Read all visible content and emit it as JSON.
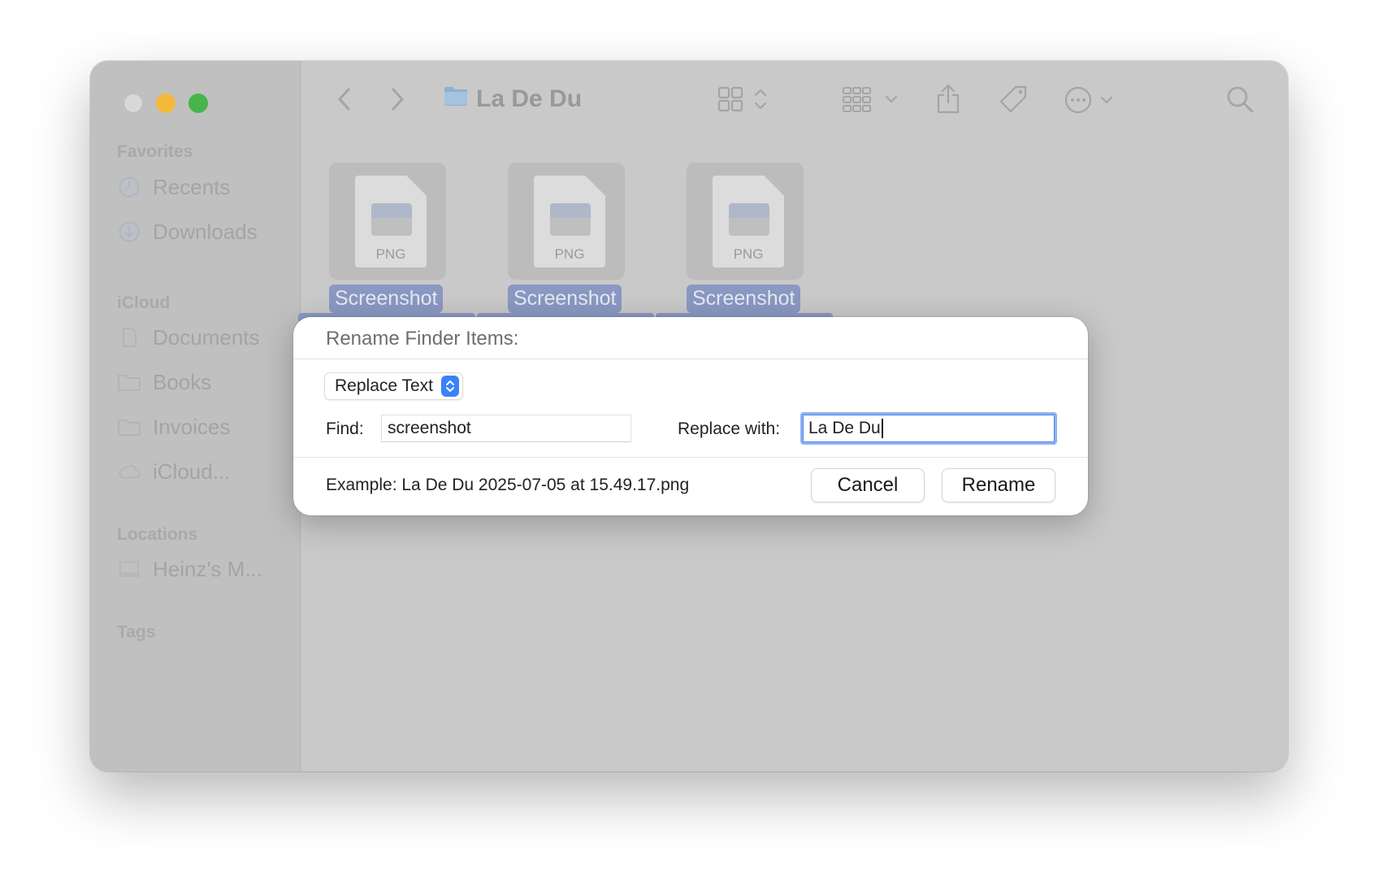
{
  "window": {
    "title": "La De Du"
  },
  "sidebar": {
    "sections": [
      {
        "label": "Favorites",
        "items": [
          {
            "label": "Recents",
            "icon": "clock-icon"
          },
          {
            "label": "Downloads",
            "icon": "download-circle-icon"
          }
        ]
      },
      {
        "label": "iCloud",
        "items": [
          {
            "label": "Documents",
            "icon": "document-icon"
          },
          {
            "label": "Books",
            "icon": "folder-icon"
          },
          {
            "label": "Invoices",
            "icon": "folder-icon"
          },
          {
            "label": "iCloud...",
            "icon": "cloud-icon"
          }
        ]
      },
      {
        "label": "Locations",
        "items": [
          {
            "label": "Heinz's M...",
            "icon": "laptop-icon"
          }
        ]
      },
      {
        "label": "Tags",
        "items": []
      }
    ]
  },
  "files": [
    {
      "ext": "PNG",
      "label": "Screenshot"
    },
    {
      "ext": "PNG",
      "label": "Screenshot"
    },
    {
      "ext": "PNG",
      "label": "Screenshot"
    }
  ],
  "dialog": {
    "title": "Rename Finder Items:",
    "mode_select": "Replace Text",
    "find_label": "Find:",
    "find_value": "screenshot",
    "replace_label": "Replace with:",
    "replace_value": "La De Du",
    "example": "Example: La De Du 2025-07-05 at 15.49.17.png",
    "cancel_label": "Cancel",
    "rename_label": "Rename"
  },
  "colors": {
    "accent": "#3b82f6",
    "selection": "#8a98c2",
    "traffic_close": "#d8d8d8",
    "traffic_minimize": "#f2b93a",
    "traffic_maximize": "#47b54a"
  }
}
